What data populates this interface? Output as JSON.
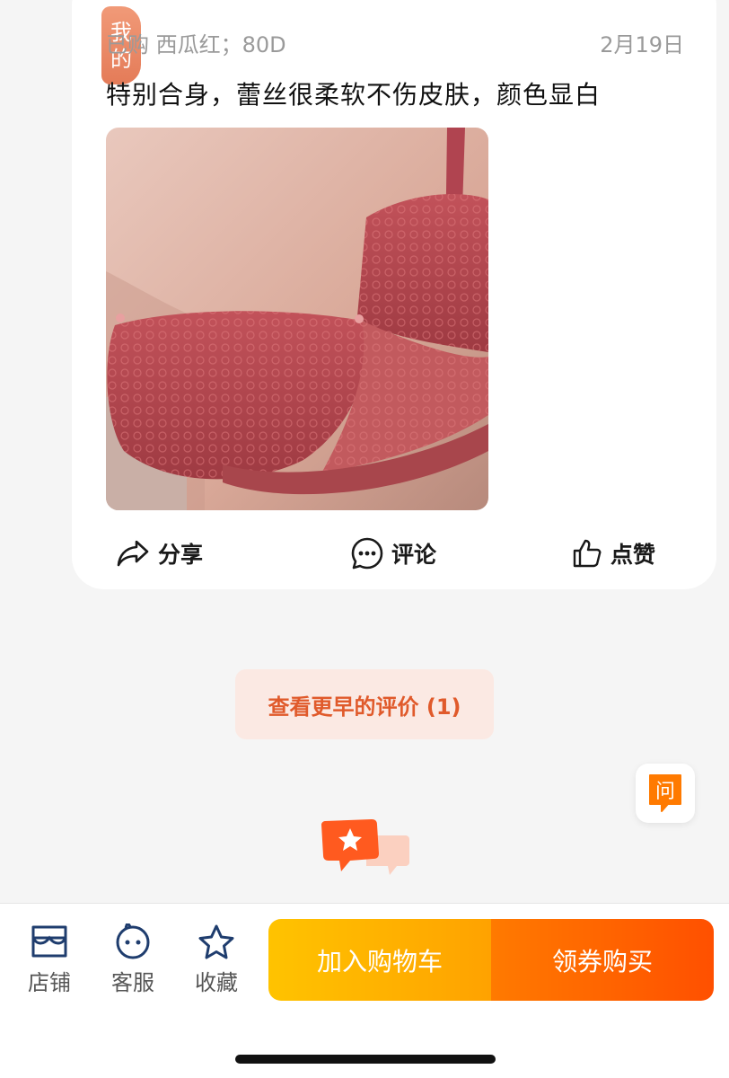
{
  "review": {
    "badge": [
      "我",
      "的"
    ],
    "purchase_info": "已购 西瓜红；80D",
    "date": "2月19日",
    "text": "特别合身，蕾丝很柔软不伤皮肤，颜色显白",
    "photo": "product-photo"
  },
  "actions": {
    "share": "分享",
    "comment": "评论",
    "like": "点赞"
  },
  "earlier_reviews": {
    "label": "查看更早的评价 (1)"
  },
  "ask_float": {
    "label": "问",
    "color": "#ff7a00"
  },
  "bottom_nav": {
    "store": "店铺",
    "service": "客服",
    "favorite": "收藏",
    "add_to_cart": "加入购物车",
    "buy": "领券购买"
  },
  "colors": {
    "accent_orange": "#ff5000",
    "accent_yellow": "#ffc300",
    "badge": "#e47b58",
    "earlier_text": "#e05a2b",
    "earlier_bg": "#fbe9e3"
  },
  "icons": {
    "share": "share-icon",
    "comment": "comment-icon",
    "like": "thumbs-up-icon",
    "store": "store-icon",
    "service": "service-face-icon",
    "favorite": "star-icon",
    "ask": "question-bubble-icon",
    "decor": "chat-bubbles-icon"
  }
}
